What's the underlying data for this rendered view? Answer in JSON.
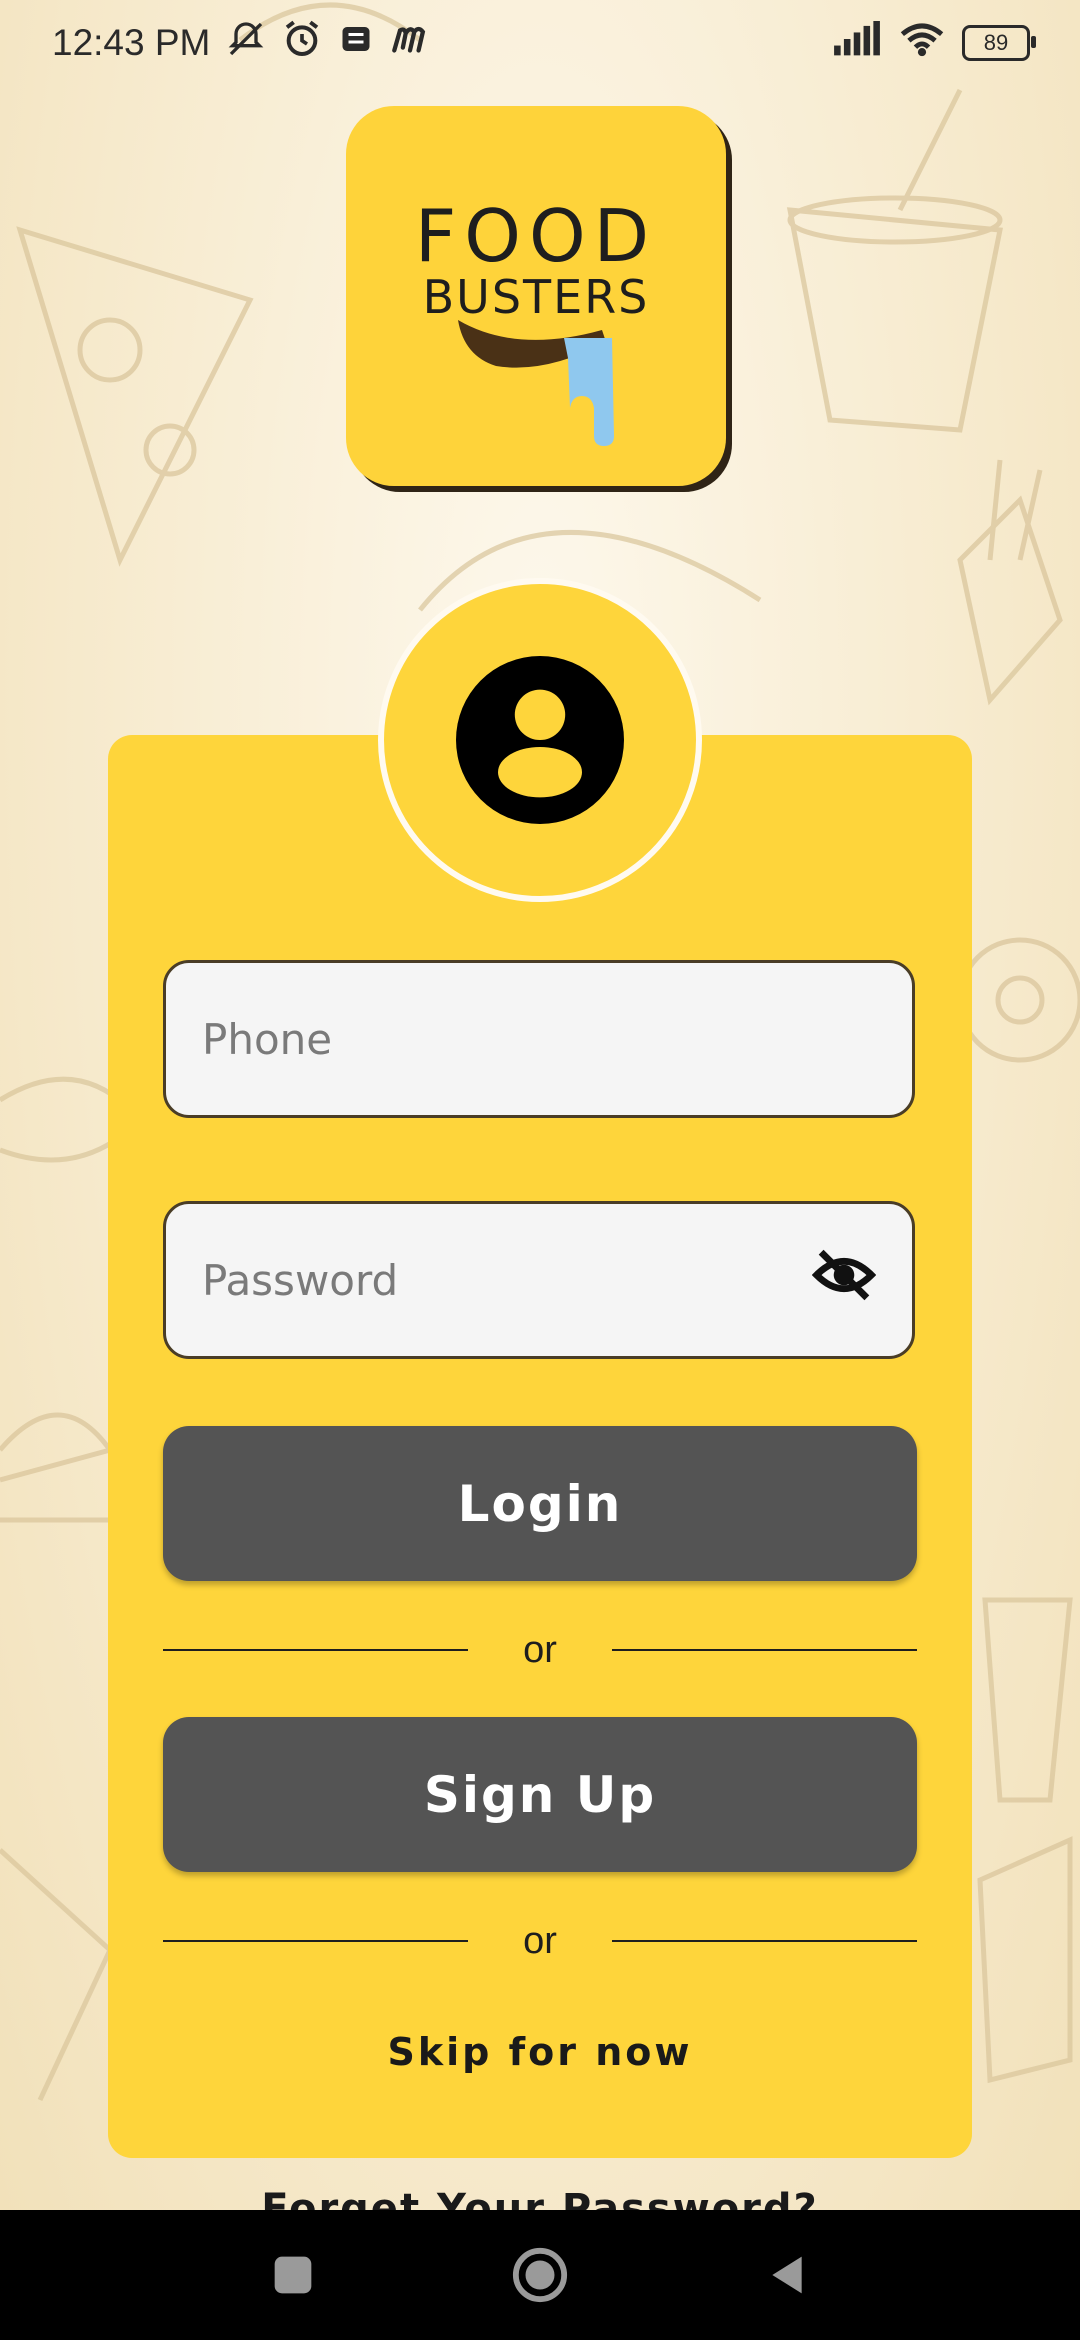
{
  "status_bar": {
    "time": "12:43 PM",
    "icons": [
      "mute-icon",
      "alarm-icon",
      "message-icon",
      "m-app-icon",
      "signal-icon",
      "wifi-icon"
    ],
    "battery": "89"
  },
  "logo": {
    "line1": "FOOD",
    "line2": "BUSTERS",
    "colors": {
      "bg": "#fed33a",
      "drip": "#8fc8ee",
      "tongue": "#4a3116"
    }
  },
  "form": {
    "phone_placeholder": "Phone",
    "password_placeholder": "Password",
    "password_toggle_icon": "eye-off-icon",
    "login_label": "Login",
    "or_1": "or",
    "signup_label": "Sign Up",
    "or_2": "or",
    "skip_label": "Skip for now"
  },
  "forgot_label": "Forget Your Password?",
  "nav": {
    "items": [
      "recents-button",
      "home-button",
      "back-button"
    ]
  },
  "colors": {
    "card": "#fed53b",
    "button": "#545454",
    "field_bg": "#f5f5f5",
    "field_border": "#4a3d26"
  }
}
